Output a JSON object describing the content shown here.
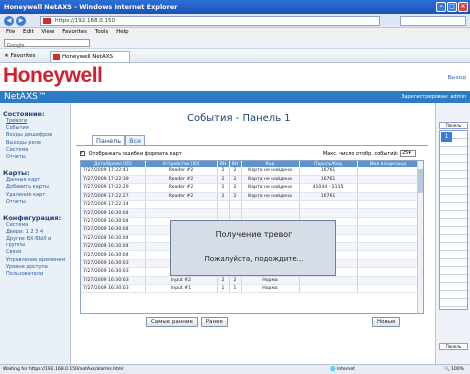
{
  "window": {
    "title": "Honeywell NetAXS - Windows Internet Explorer"
  },
  "browser": {
    "url": "https://192.168.0.150",
    "search_placeholder": "Google",
    "menu": [
      "File",
      "Edit",
      "View",
      "Favorites",
      "Tools",
      "Help"
    ],
    "google_label": "Google",
    "favorites_label": "Favorites",
    "tab_title": "Honeywell NetAXS"
  },
  "header": {
    "logo": "Honeywell",
    "logout": "Выход",
    "app_name": "NetAXS™",
    "user_text": "Зарегистрирован: admin"
  },
  "sidebar": {
    "sections": [
      {
        "heading": "Состояние:",
        "items": [
          "Тревоги",
          "События",
          "Входы дешифров",
          "Выходы реле",
          "Система",
          "Отчеты"
        ]
      },
      {
        "heading": "Карты:",
        "items": [
          "Данные карт",
          "Добавить карты",
          "Удаление карт",
          "Отчеты"
        ]
      },
      {
        "heading": "Конфигурация:",
        "items": [
          "Система",
          "Двери: 1 2 3 4",
          "Другие ВХ-ВЫХ и группы",
          "Связи",
          "Управление временем",
          "Уровни доступа",
          "Пользователи"
        ]
      }
    ]
  },
  "main": {
    "title": "События - Панель 1",
    "tabs": [
      {
        "label": "Панель",
        "active": true
      },
      {
        "label": "Все",
        "active": false
      }
    ],
    "show_card_format_errors": "Отображать ошибки формата карт",
    "max_rows_label": "Макс. число отобр. событий:",
    "max_rows_value": "25",
    "columns": [
      "Дата/Время [ID]",
      "Устройство [ID]",
      "ВН",
      "ВН",
      "Код",
      "Пароль/Код",
      "Имя владельца"
    ],
    "rows": [
      [
        "7/27/2009 17:22:41",
        "Reader #2",
        "2",
        "2",
        "Карта не найдена",
        "16761",
        ""
      ],
      [
        "7/27/2009 17:22:39",
        "Reader #2",
        "2",
        "2",
        "Карта не найдена",
        "16761",
        ""
      ],
      [
        "7/27/2009 17:22:29",
        "Reader #2",
        "2",
        "2",
        "Карта не найдена",
        "41044 - 2115",
        ""
      ],
      [
        "7/27/2009 17:22:27",
        "Reader #2",
        "2",
        "2",
        "Карта не найдена",
        "16761",
        ""
      ],
      [
        "7/27/2009 17:22:14",
        "",
        "",
        "",
        "",
        "",
        ""
      ],
      [
        "7/27/2009 16:30:04",
        "",
        "",
        "",
        "",
        "",
        ""
      ],
      [
        "7/27/2009 16:30:04",
        "",
        "",
        "",
        "",
        "",
        ""
      ],
      [
        "7/27/2009 16:30:04",
        "",
        "",
        "",
        "",
        "",
        ""
      ],
      [
        "7/27/2009 16:30:04",
        "",
        "",
        "",
        "",
        "",
        ""
      ],
      [
        "7/27/2009 16:30:04",
        "Input #6",
        "6",
        "6",
        "Норма",
        "",
        ""
      ],
      [
        "7/27/2009 16:30:04",
        "Input #5",
        "5",
        "5",
        "Норма",
        "",
        ""
      ],
      [
        "7/27/2009 16:30:03",
        "Input #4",
        "4",
        "4",
        "Норма",
        "",
        ""
      ],
      [
        "7/27/2009 16:30:03",
        "Input #3",
        "3",
        "3",
        "Норма",
        "",
        ""
      ],
      [
        "7/27/2009 16:30:03",
        "Input #2",
        "2",
        "2",
        "Норма",
        "",
        ""
      ],
      [
        "7/27/2009 16:30:03",
        "Input #1",
        "1",
        "1",
        "Норма",
        "",
        ""
      ]
    ],
    "modal": {
      "line1": "Получение тревог",
      "line2": "Пожалуйста, подождите..."
    },
    "buttons": {
      "earliest": "Самые ранние",
      "earlier": "Ранее",
      "newer": "Новые"
    }
  },
  "right_panel": {
    "header": "Панель",
    "selected": "1",
    "footer": "Панель"
  },
  "statusbar": {
    "left": "Waiting for https://192.168.0.150/netAxs/alarms.html",
    "zone": "Internet",
    "zoom": "100%"
  }
}
